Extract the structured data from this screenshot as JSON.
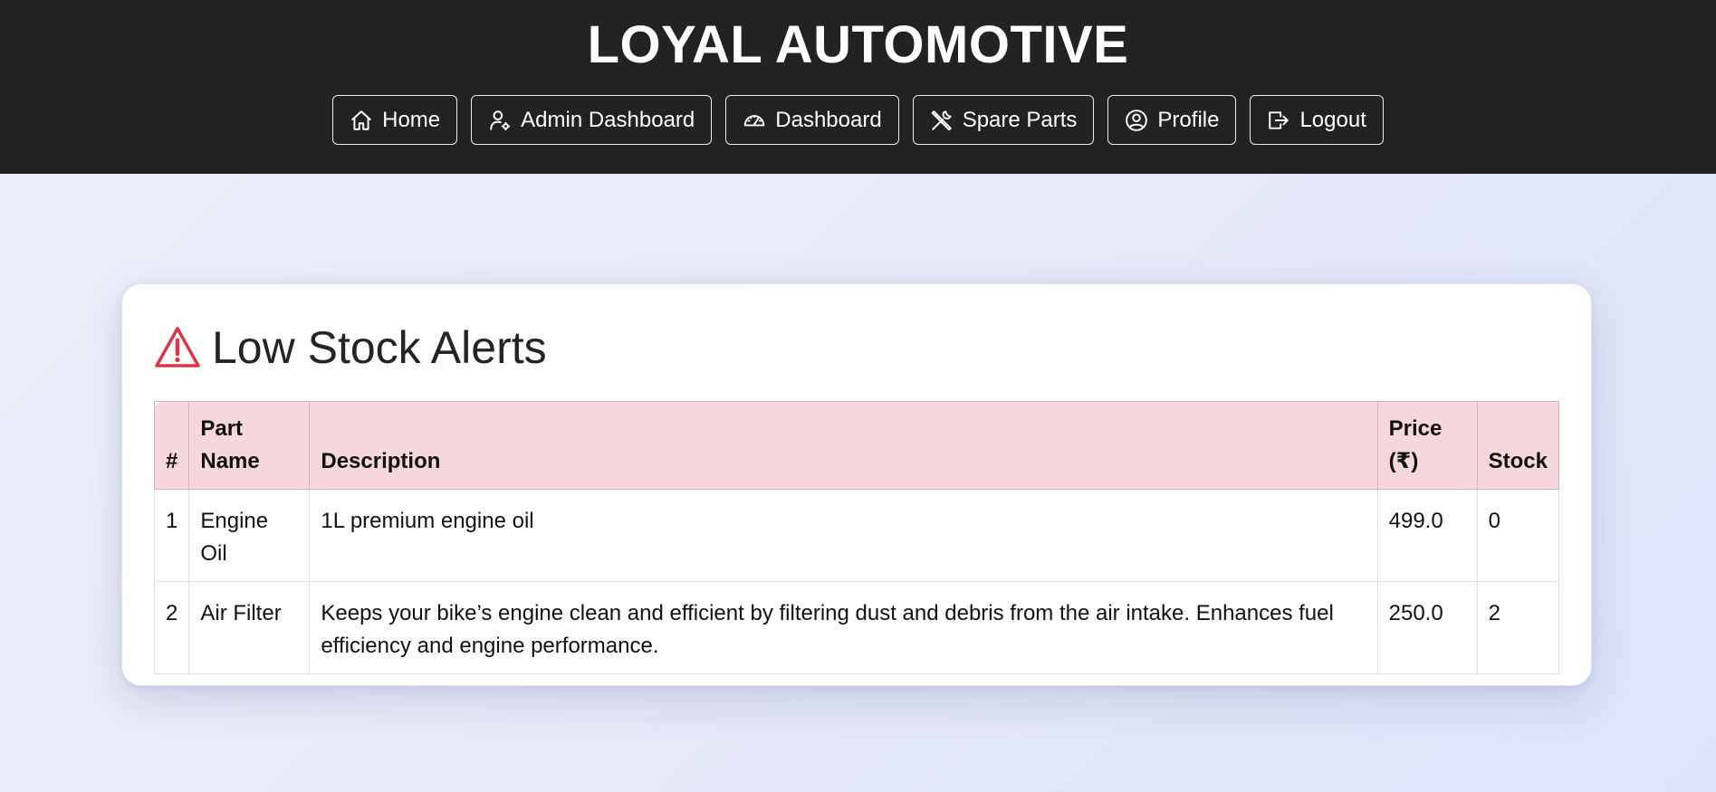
{
  "header": {
    "brand": "LOYAL AUTOMOTIVE",
    "nav": [
      {
        "label": "Home",
        "icon": "home-icon"
      },
      {
        "label": "Admin Dashboard",
        "icon": "user-gear-icon"
      },
      {
        "label": "Dashboard",
        "icon": "speedometer-icon"
      },
      {
        "label": "Spare Parts",
        "icon": "tools-icon"
      },
      {
        "label": "Profile",
        "icon": "person-circle-icon"
      },
      {
        "label": "Logout",
        "icon": "logout-icon"
      }
    ]
  },
  "alerts": {
    "title": "Low Stock Alerts",
    "icon": "warning-triangle-icon",
    "accent_color": "#dc3545",
    "header_bg": "#f6d7db",
    "columns": {
      "num": "#",
      "name": "Part Name",
      "description": "Description",
      "price": "Price (₹)",
      "stock": "Stock"
    },
    "rows": [
      {
        "num": "1",
        "name": "Engine Oil",
        "description": "1L premium engine oil",
        "price": "499.0",
        "stock": "0"
      },
      {
        "num": "2",
        "name": "Air Filter",
        "description": "Keeps your bike’s engine clean and efficient by filtering dust and debris from the air intake. Enhances fuel efficiency and engine performance.",
        "price": "250.0",
        "stock": "2"
      }
    ]
  }
}
